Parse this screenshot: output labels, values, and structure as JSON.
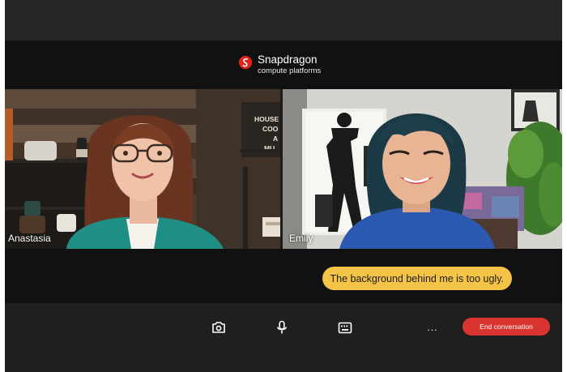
{
  "brand": {
    "name": "Snapdragon",
    "subtitle": "compute platforms",
    "logo_icon": "snapdragon-logo-icon",
    "color": "#e2231a"
  },
  "participants": [
    {
      "name": "Anastasia"
    },
    {
      "name": "Emily"
    }
  ],
  "background_sign": [
    "HOUSE",
    "COO",
    "A",
    "MU"
  ],
  "caption": {
    "text": "The background behind me is too ugly.",
    "color": "#f5c446"
  },
  "controls": {
    "camera_icon": "camera-icon",
    "mic_icon": "microphone-icon",
    "keyboard_icon": "keyboard-icon",
    "more_label": "...",
    "end_label": "End conversation",
    "end_color": "#d9342f"
  }
}
